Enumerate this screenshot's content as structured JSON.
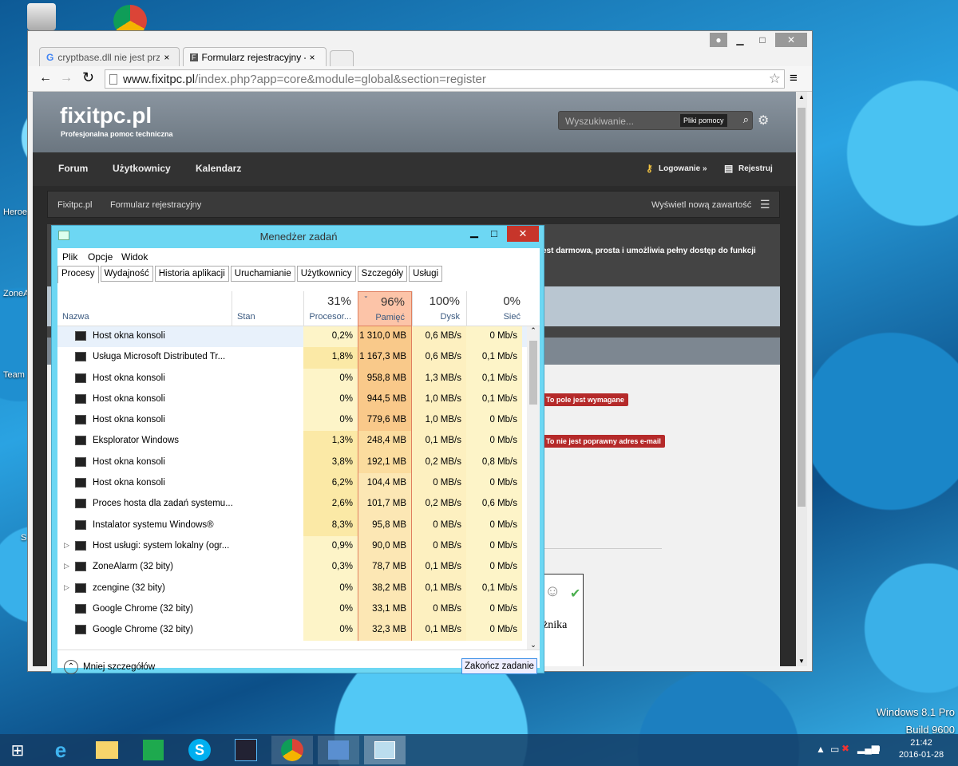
{
  "desktop": {
    "labels": [
      "Heroe",
      "ZoneA",
      "Team",
      "S"
    ],
    "watermark": {
      "line1": "Windows 8.1 Pro",
      "line2": "Build 9600"
    }
  },
  "browser": {
    "tabs": [
      {
        "label": "cryptbase.dll nie jest przez",
        "close": "×"
      },
      {
        "label": "Formularz rejestracyjny - F",
        "close": "×"
      }
    ],
    "url_host": "www.fixitpc.pl",
    "url_path": "/index.php?app=core&module=global&section=register",
    "site": {
      "logo": "fixitpc.pl",
      "tagline": "Profesjonalna pomoc techniczna",
      "search_placeholder": "Wyszukiwanie...",
      "search_scope": "Pliki pomocy",
      "nav": [
        "Forum",
        "Użytkownicy",
        "Kalendarz"
      ],
      "login": "Logowanie »",
      "register": "Rejestruj",
      "breadcrumb": [
        "Fixitpc.pl",
        "Formularz rejestracyjny"
      ],
      "new_content": "Wyświetl nową zawartość",
      "intro": "est darmowa, prosta i umożliwia pełny dostęp do funkcji",
      "error_required": "To pole jest wymagane",
      "error_email": "To nie jest poprawny adres e-mail",
      "captcha_text": "żnika"
    }
  },
  "taskmanager": {
    "title": "Menedżer zadań",
    "menu": [
      "Plik",
      "Opcje",
      "Widok"
    ],
    "tabs": [
      "Procesy",
      "Wydajność",
      "Historia aplikacji",
      "Uruchamianie",
      "Użytkownicy",
      "Szczegóły",
      "Usługi"
    ],
    "columns": {
      "name": "Nazwa",
      "status": "Stan",
      "cpu": {
        "pct": "31%",
        "label": "Procesor..."
      },
      "mem": {
        "pct": "96%",
        "label": "Pamięć"
      },
      "disk": {
        "pct": "100%",
        "label": "Dysk"
      },
      "net": {
        "pct": "0%",
        "label": "Sieć"
      }
    },
    "rows": [
      {
        "name": "Host okna konsoli",
        "cpu": "0,2%",
        "mem": "1 310,0 MB",
        "disk": "0,6 MB/s",
        "net": "0 Mb/s"
      },
      {
        "name": "Usługa Microsoft Distributed Tr...",
        "cpu": "1,8%",
        "mem": "1 167,3 MB",
        "disk": "0,6 MB/s",
        "net": "0,1 Mb/s"
      },
      {
        "name": "Host okna konsoli",
        "cpu": "0%",
        "mem": "958,8 MB",
        "disk": "1,3 MB/s",
        "net": "0,1 Mb/s"
      },
      {
        "name": "Host okna konsoli",
        "cpu": "0%",
        "mem": "944,5 MB",
        "disk": "1,0 MB/s",
        "net": "0,1 Mb/s"
      },
      {
        "name": "Host okna konsoli",
        "cpu": "0%",
        "mem": "779,6 MB",
        "disk": "1,0 MB/s",
        "net": "0 Mb/s"
      },
      {
        "name": "Eksplorator Windows",
        "cpu": "1,3%",
        "mem": "248,4 MB",
        "disk": "0,1 MB/s",
        "net": "0 Mb/s"
      },
      {
        "name": "Host okna konsoli",
        "cpu": "3,8%",
        "mem": "192,1 MB",
        "disk": "0,2 MB/s",
        "net": "0,8 Mb/s"
      },
      {
        "name": "Host okna konsoli",
        "cpu": "6,2%",
        "mem": "104,4 MB",
        "disk": "0 MB/s",
        "net": "0 Mb/s"
      },
      {
        "name": "Proces hosta dla zadań systemu...",
        "cpu": "2,6%",
        "mem": "101,7 MB",
        "disk": "0,2 MB/s",
        "net": "0,6 Mb/s"
      },
      {
        "name": "Instalator systemu Windows®",
        "cpu": "8,3%",
        "mem": "95,8 MB",
        "disk": "0 MB/s",
        "net": "0 Mb/s"
      },
      {
        "name": "Host usługi: system lokalny (ogr...",
        "cpu": "0,9%",
        "mem": "90,0 MB",
        "disk": "0 MB/s",
        "net": "0 Mb/s"
      },
      {
        "name": "ZoneAlarm (32 bity)",
        "cpu": "0,3%",
        "mem": "78,7 MB",
        "disk": "0,1 MB/s",
        "net": "0 Mb/s"
      },
      {
        "name": "zcengine (32 bity)",
        "cpu": "0%",
        "mem": "38,2 MB",
        "disk": "0,1 MB/s",
        "net": "0,1 Mb/s"
      },
      {
        "name": "Google Chrome (32 bity)",
        "cpu": "0%",
        "mem": "33,1 MB",
        "disk": "0 MB/s",
        "net": "0 Mb/s"
      },
      {
        "name": "Google Chrome (32 bity)",
        "cpu": "0%",
        "mem": "32,3 MB",
        "disk": "0,1 MB/s",
        "net": "0 Mb/s"
      }
    ],
    "less_details": "Mniej szczegółów",
    "end_task": "Zakończ zadanie"
  },
  "taskbar": {
    "time": "21:42",
    "date": "2016-01-28"
  }
}
